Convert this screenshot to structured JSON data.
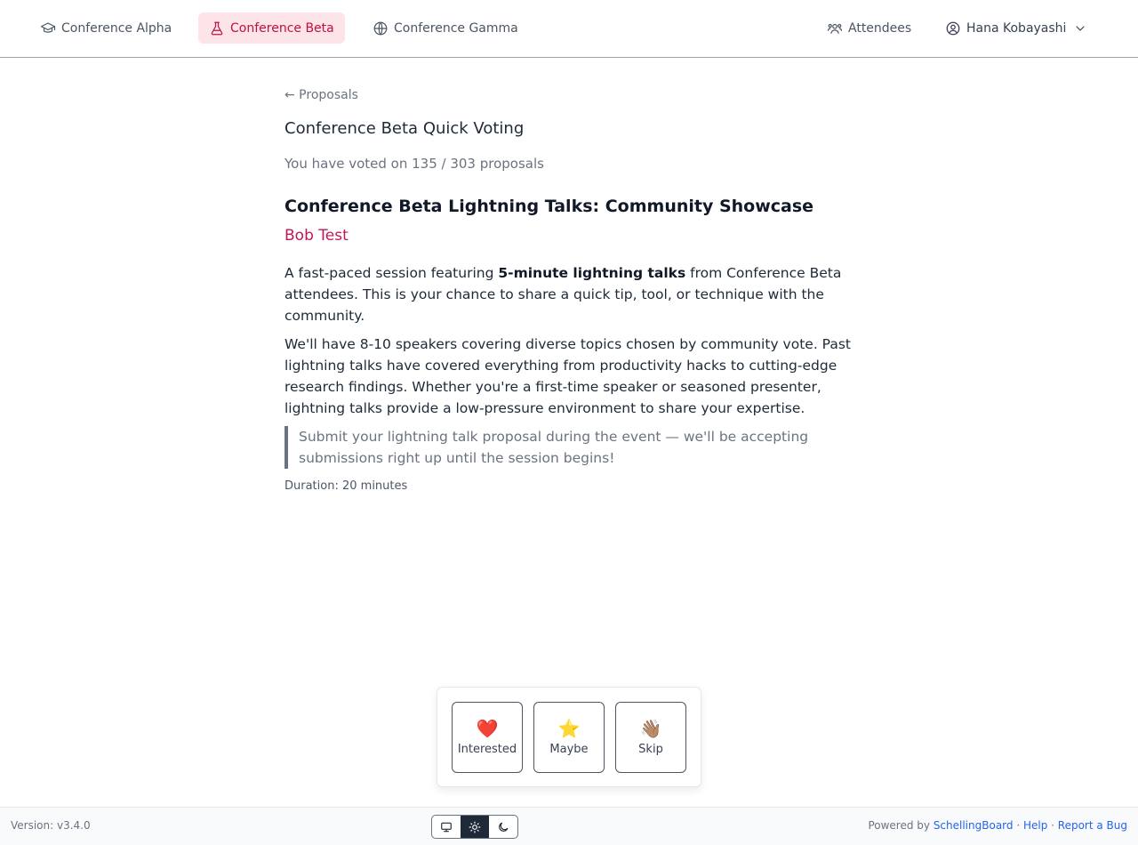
{
  "nav": {
    "items": [
      {
        "label": "Conference Alpha",
        "icon": "graduation-cap-icon"
      },
      {
        "label": "Conference Beta",
        "icon": "flask-icon",
        "active": true
      },
      {
        "label": "Conference Gamma",
        "icon": "globe-icon"
      }
    ],
    "attendees_label": "Attendees",
    "user_name": "Hana Kobayashi"
  },
  "page": {
    "back_label": "← Proposals",
    "title": "Conference Beta Quick Voting",
    "progress": "You have voted on 135 / 303 proposals"
  },
  "proposal": {
    "title": "Conference Beta Lightning Talks: Community Showcase",
    "speaker": "Bob Test",
    "p1_before": "A fast-paced session featuring ",
    "p1_bold": "5-minute lightning talks",
    "p1_after": " from Conference Beta attendees. This is your chance to share a quick tip, tool, or technique with the community.",
    "p2": "We'll have 8-10 speakers covering diverse topics chosen by community vote. Past lightning talks have covered everything from productivity hacks to cutting-edge research findings. Whether you're a first-time speaker or seasoned presenter, lightning talks provide a low-pressure environment to share your expertise.",
    "quote": "Submit your lightning talk proposal during the event — we'll be accepting submissions right up until the session begins!",
    "duration": "Duration: 20 minutes"
  },
  "vote": {
    "buttons": [
      {
        "emoji": "❤️",
        "label": "Interested"
      },
      {
        "emoji": "⭐",
        "label": "Maybe"
      },
      {
        "emoji": "👋🏽",
        "label": "Skip"
      }
    ]
  },
  "footer": {
    "version": "Version: v3.4.0",
    "powered_prefix": "Powered by ",
    "powered_link": "SchellingBoard",
    "sep1": " · ",
    "help": "Help",
    "sep2": " · ",
    "report": "Report a Bug",
    "theme_active": "light"
  },
  "colors": {
    "accent": "#be123c",
    "active_bg": "#fde4e8",
    "speaker": "#be185d",
    "link": "#2563eb"
  }
}
